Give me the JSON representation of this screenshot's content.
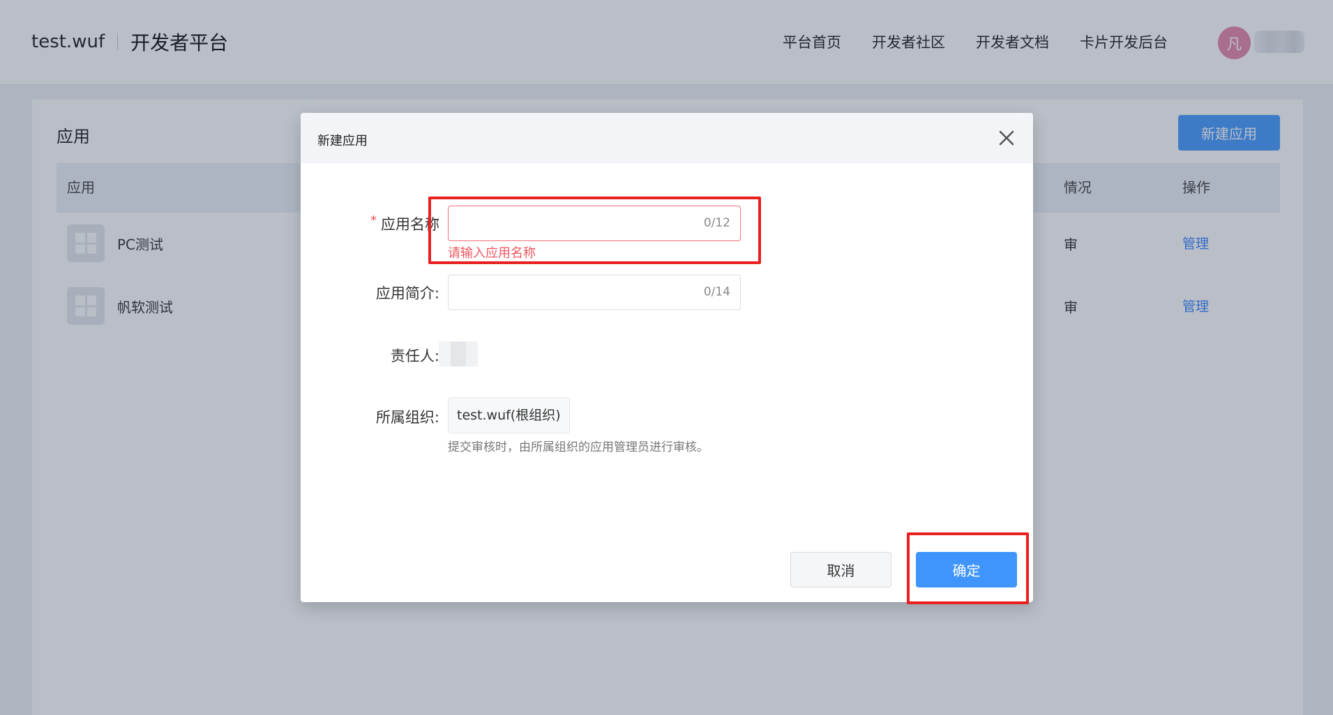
{
  "header": {
    "org_name": "test.wuf",
    "product_name": "开发者平台",
    "nav": [
      "平台首页",
      "开发者社区",
      "开发者文档",
      "卡片开发后台"
    ],
    "avatar_char": "凡"
  },
  "page": {
    "title": "应用",
    "new_app_label": "新建应用",
    "columns": {
      "app": "应用",
      "status": "情况",
      "actions": "操作"
    },
    "rows": [
      {
        "name": "PC测试",
        "status": "审",
        "action": "管理"
      },
      {
        "name": "帆软测试",
        "status": "审",
        "action": "管理"
      }
    ]
  },
  "modal": {
    "title": "新建应用",
    "fields": {
      "name": {
        "label": "应用名称",
        "required_mark": "*",
        "value": "",
        "counter": "0/12",
        "error": "请输入应用名称"
      },
      "intro": {
        "label": "应用简介:",
        "value": "",
        "counter": "0/14"
      },
      "owner": {
        "label": "责任人:"
      },
      "org": {
        "label": "所属组织:",
        "value": "test.wuf(根组织)",
        "hint": "提交审核时，由所属组织的应用管理员进行审核。"
      }
    },
    "cancel_label": "取消",
    "confirm_label": "确定"
  },
  "colors": {
    "primary": "#3f95fb",
    "error": "#f0555e",
    "highlight": "#e8201f",
    "link": "#3a86ff"
  }
}
